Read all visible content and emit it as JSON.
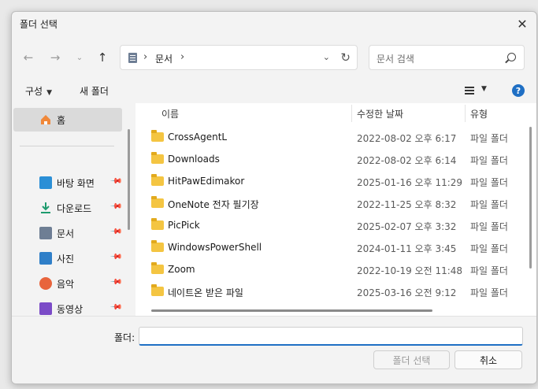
{
  "window": {
    "title": "폴더 선택"
  },
  "address": {
    "segment": "문서"
  },
  "search": {
    "placeholder": "문서 검색"
  },
  "toolbar": {
    "organize": "구성",
    "new_folder": "새 폴더"
  },
  "sidebar": {
    "items": [
      {
        "label": "홈",
        "icon": "home-icon",
        "color": "#f0883a",
        "pinned": false
      },
      {
        "label": "바탕 화면",
        "icon": "desktop-icon",
        "color": "#2b8fd6",
        "pinned": true
      },
      {
        "label": "다운로드",
        "icon": "download-icon",
        "color": "#1e9b6e",
        "pinned": true
      },
      {
        "label": "문서",
        "icon": "document-icon",
        "color": "#6e7e94",
        "pinned": true
      },
      {
        "label": "사진",
        "icon": "pictures-icon",
        "color": "#2f7fc8",
        "pinned": true
      },
      {
        "label": "음악",
        "icon": "music-icon",
        "color": "#e8643c",
        "pinned": true
      },
      {
        "label": "동영상",
        "icon": "videos-icon",
        "color": "#7b4bc7",
        "pinned": true
      }
    ]
  },
  "columns": {
    "name": "이름",
    "date": "수정한 날짜",
    "type": "유형"
  },
  "files": [
    {
      "name": "CrossAgentL",
      "date": "2022-08-02 오후 6:17",
      "type": "파일 폴더"
    },
    {
      "name": "Downloads",
      "date": "2022-08-02 오후 6:14",
      "type": "파일 폴더"
    },
    {
      "name": "HitPawEdimakor",
      "date": "2025-01-16 오후 11:29",
      "type": "파일 폴더"
    },
    {
      "name": "OneNote 전자 필기장",
      "date": "2022-11-25 오후 8:32",
      "type": "파일 폴더"
    },
    {
      "name": "PicPick",
      "date": "2025-02-07 오후 3:32",
      "type": "파일 폴더"
    },
    {
      "name": "WindowsPowerShell",
      "date": "2024-01-11 오후 3:45",
      "type": "파일 폴더"
    },
    {
      "name": "Zoom",
      "date": "2022-10-19 오전 11:48",
      "type": "파일 폴더"
    },
    {
      "name": "네이트온 받은 파일",
      "date": "2025-03-16 오전 9:12",
      "type": "파일 폴더"
    }
  ],
  "footer": {
    "folder_label": "폴더:",
    "folder_value": "",
    "select_label": "폴더 선택",
    "cancel_label": "취소"
  },
  "colors": {
    "accent": "#1f6fc4",
    "folder": "#f4c542"
  }
}
